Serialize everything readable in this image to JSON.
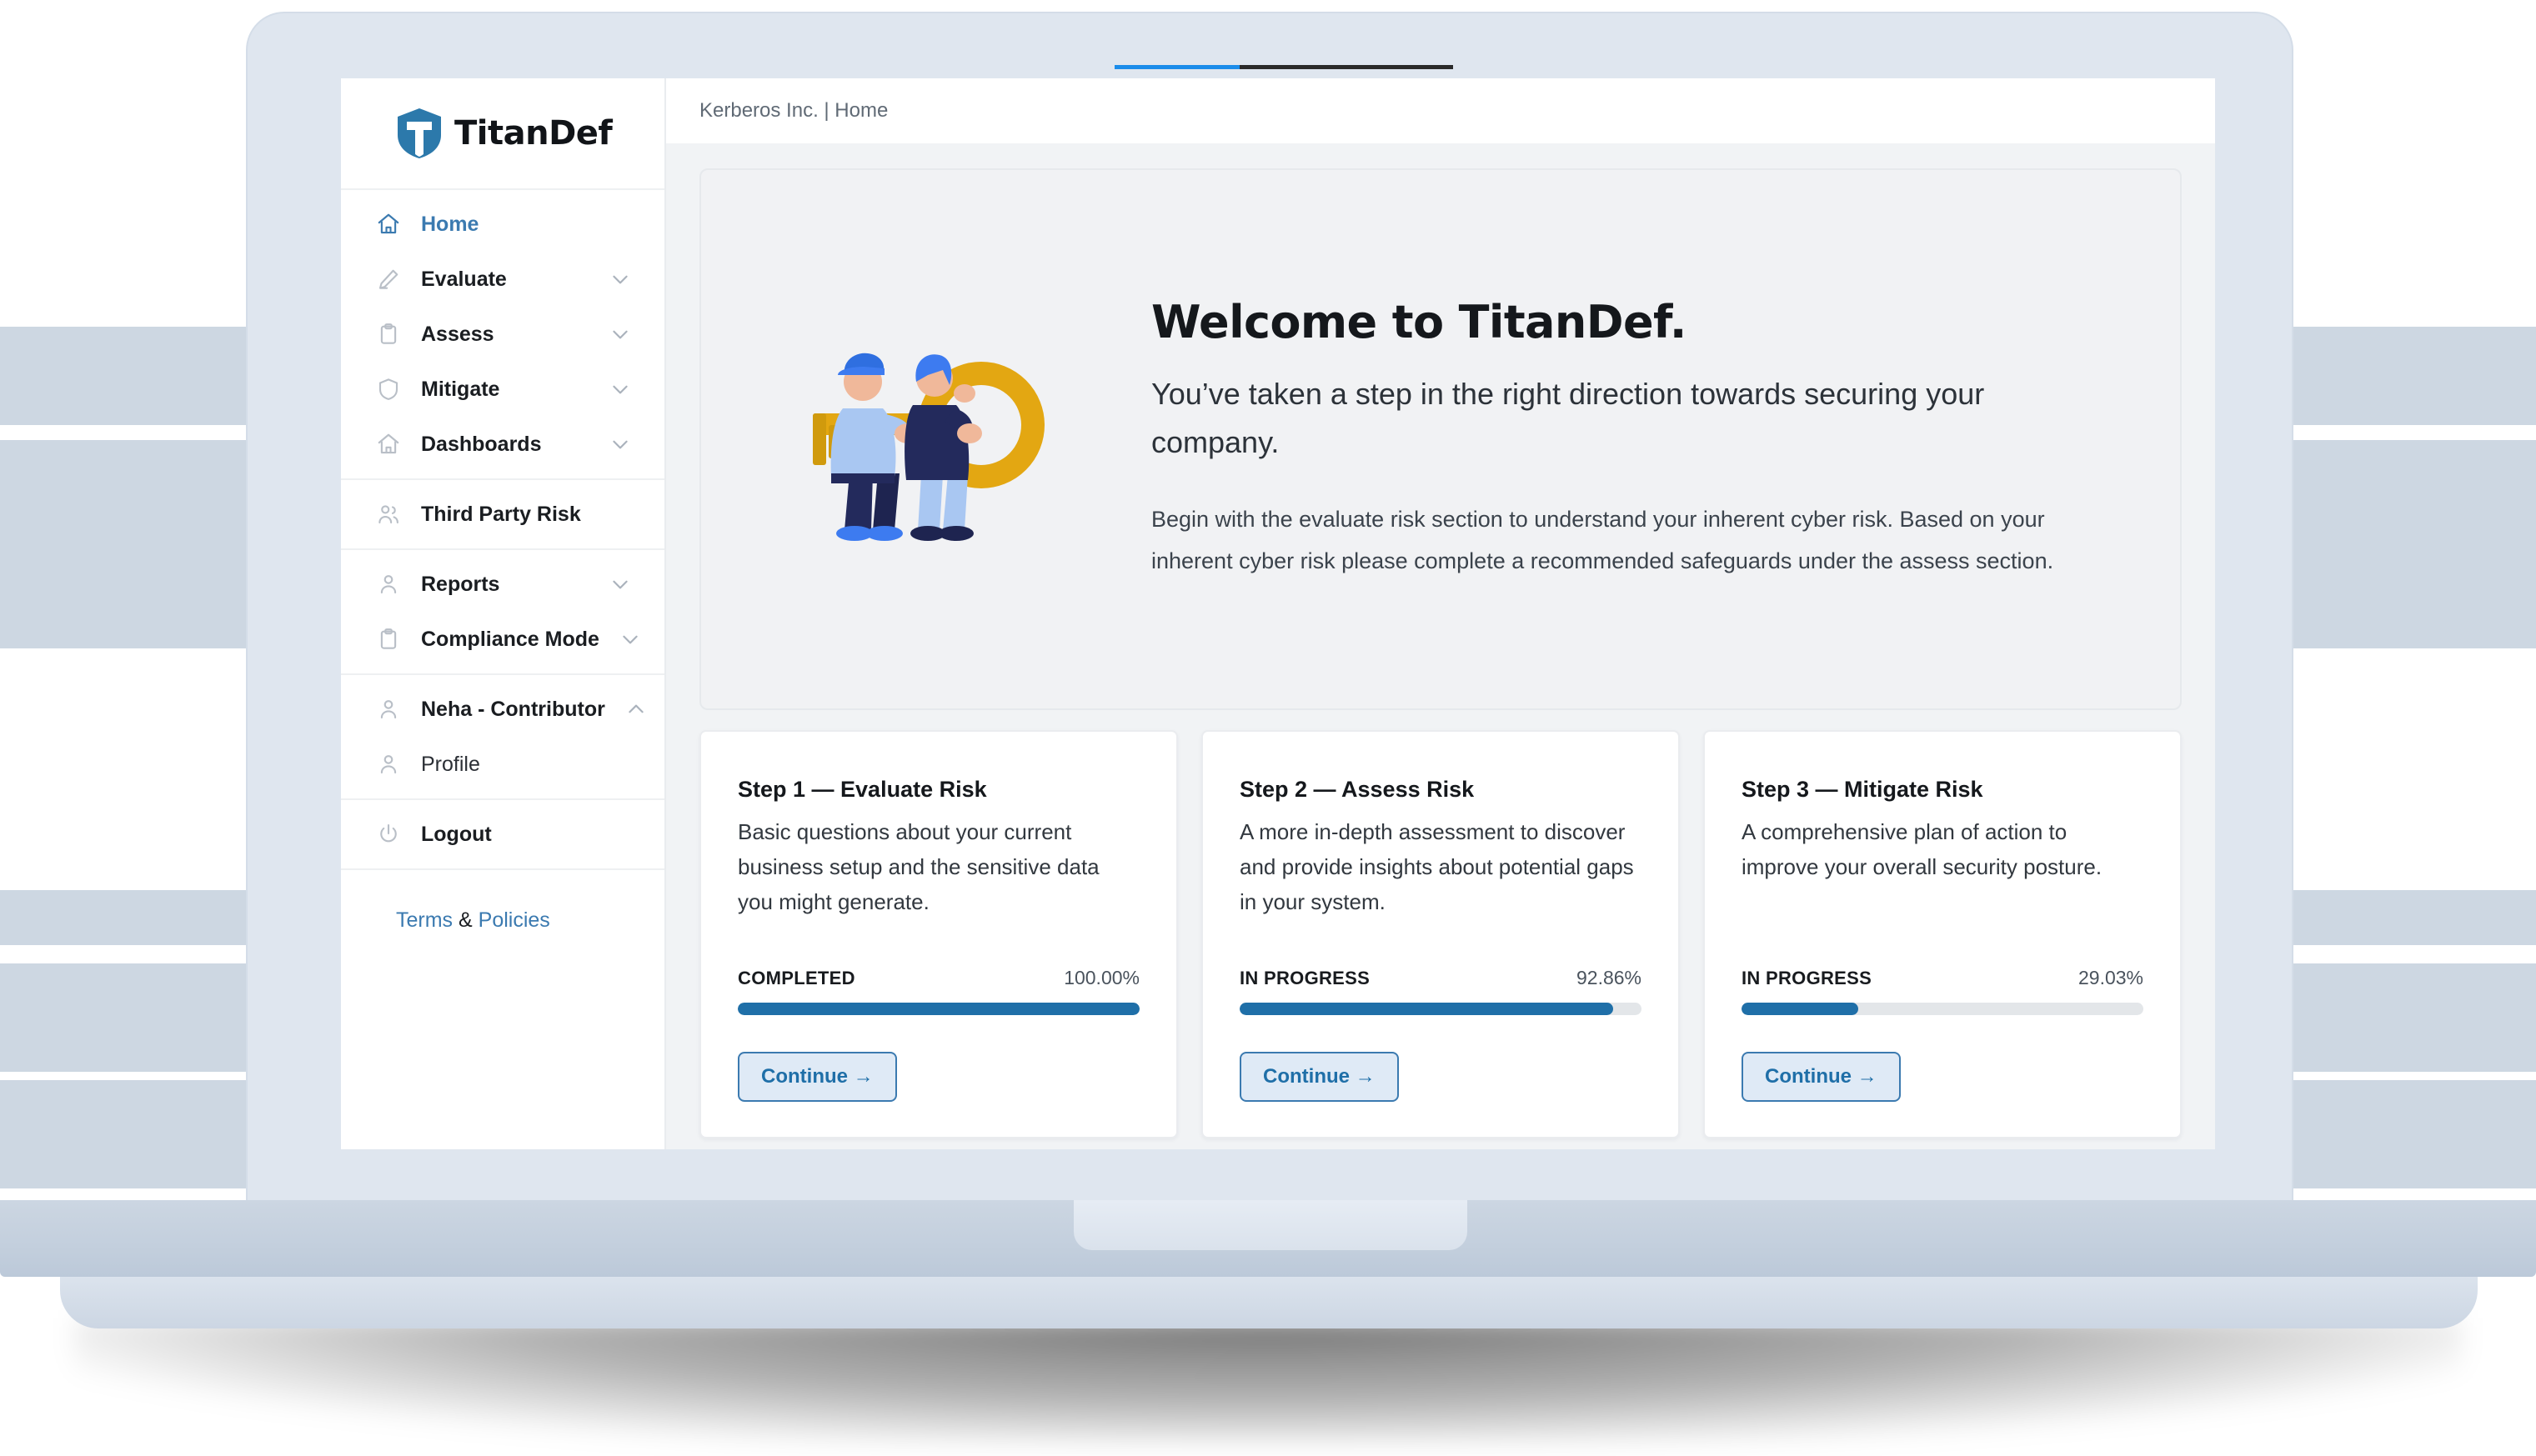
{
  "brand": {
    "name": "TitanDef",
    "logo_icon": "shield-t-logo"
  },
  "topbar": {
    "breadcrumb": "Kerberos Inc. | Home"
  },
  "colors": {
    "accent_blue": "#3b7ab0",
    "progress_blue": "#1f6fa8",
    "logo_blue": "#2c79ab",
    "link_blue": "#3b7ab0",
    "bezel": "#dfe6ef",
    "content_bg": "#f1f3f5",
    "hero_bg": "#f1f2f4"
  },
  "sidebar": {
    "groups": [
      {
        "items": [
          {
            "label": "Home",
            "icon": "home-icon",
            "active": true,
            "chevron": null
          },
          {
            "label": "Evaluate",
            "icon": "pencil-icon",
            "active": false,
            "chevron": "chevron-down-icon"
          },
          {
            "label": "Assess",
            "icon": "clipboard-icon",
            "active": false,
            "chevron": "chevron-down-icon"
          },
          {
            "label": "Mitigate",
            "icon": "shield-icon",
            "active": false,
            "chevron": "chevron-down-icon"
          },
          {
            "label": "Dashboards",
            "icon": "home-icon",
            "active": false,
            "chevron": "chevron-down-icon"
          }
        ]
      },
      {
        "items": [
          {
            "label": "Third Party Risk",
            "icon": "users-icon",
            "active": false,
            "chevron": null
          }
        ]
      },
      {
        "items": [
          {
            "label": "Reports",
            "icon": "user-icon",
            "active": false,
            "chevron": "chevron-down-icon"
          },
          {
            "label": "Compliance Mode",
            "icon": "clipboard-icon",
            "active": false,
            "chevron": "chevron-down-icon"
          }
        ]
      },
      {
        "items": [
          {
            "label": "Neha - Contributor",
            "icon": "user-icon",
            "active": false,
            "chevron": "chevron-up-icon"
          },
          {
            "label": "Profile",
            "icon": "user-icon",
            "active": false,
            "chevron": null,
            "sub": true
          }
        ]
      },
      {
        "items": [
          {
            "label": "Logout",
            "icon": "power-icon",
            "active": false,
            "chevron": null
          }
        ]
      }
    ],
    "legal": {
      "terms": "Terms",
      "amp": " & ",
      "policies": "Policies"
    }
  },
  "hero": {
    "illustration": "two-people-carrying-key-illustration",
    "title": "Welcome to TitanDef.",
    "subtitle": "You’ve taken a step in the right direction towards securing your company.",
    "paragraph": "Begin with the evaluate risk section to understand your inherent cyber risk. Based on your inherent cyber risk please complete a recommended safeguards under the assess section."
  },
  "cards": [
    {
      "title": "Step 1 — Evaluate Risk",
      "description": "Basic questions about your current business setup and the sensitive data you might generate.",
      "status": "COMPLETED",
      "percent_label": "100.00%",
      "percent_value": 100,
      "button": "Continue →"
    },
    {
      "title": "Step 2 — Assess Risk",
      "description": "A more in-depth assessment to discover and provide insights about potential gaps in your system.",
      "status": "IN PROGRESS",
      "percent_label": "92.86%",
      "percent_value": 92.86,
      "button": "Continue →"
    },
    {
      "title": "Step 3 — Mitigate Risk",
      "description": "A comprehensive plan of action to improve your overall security posture.",
      "status": "IN PROGRESS",
      "percent_label": "29.03%",
      "percent_value": 29.03,
      "button": "Continue →"
    }
  ]
}
